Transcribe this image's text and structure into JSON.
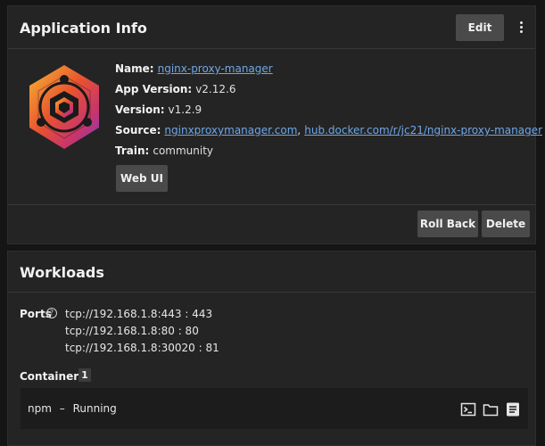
{
  "app_info": {
    "title": "Application Info",
    "edit_label": "Edit",
    "fields": {
      "name_label": "Name:",
      "name_value": "nginx-proxy-manager",
      "app_version_label": "App Version:",
      "app_version_value": "v2.12.6",
      "version_label": "Version:",
      "version_value": "v1.2.9",
      "source_label": "Source:",
      "source_link_1": "nginxproxymanager.com",
      "source_separator": ",",
      "source_link_2": "hub.docker.com/r/jc21/nginx-proxy-manager",
      "train_label": "Train:",
      "train_value": "community"
    },
    "web_ui_label": "Web UI",
    "roll_back_label": "Roll Back",
    "delete_label": "Delete",
    "icon": "nginx-proxy-manager-logo"
  },
  "workloads": {
    "title": "Workloads",
    "ports_label": "Ports",
    "help_icon_glyph": "?",
    "ports": [
      "tcp://192.168.1.8:443 : 443",
      "tcp://192.168.1.8:80 : 80",
      "tcp://192.168.1.8:30020 : 81"
    ],
    "containers_label": "Containers",
    "containers_count": "1",
    "containers": [
      {
        "name": "npm",
        "separator": "–",
        "status": "Running"
      }
    ],
    "row_icons": [
      "terminal-icon",
      "folder-icon",
      "logs-icon"
    ]
  },
  "colors": {
    "background": "#151515",
    "card": "#242424",
    "button": "#4a4a4a",
    "link": "#6fa6e6"
  }
}
